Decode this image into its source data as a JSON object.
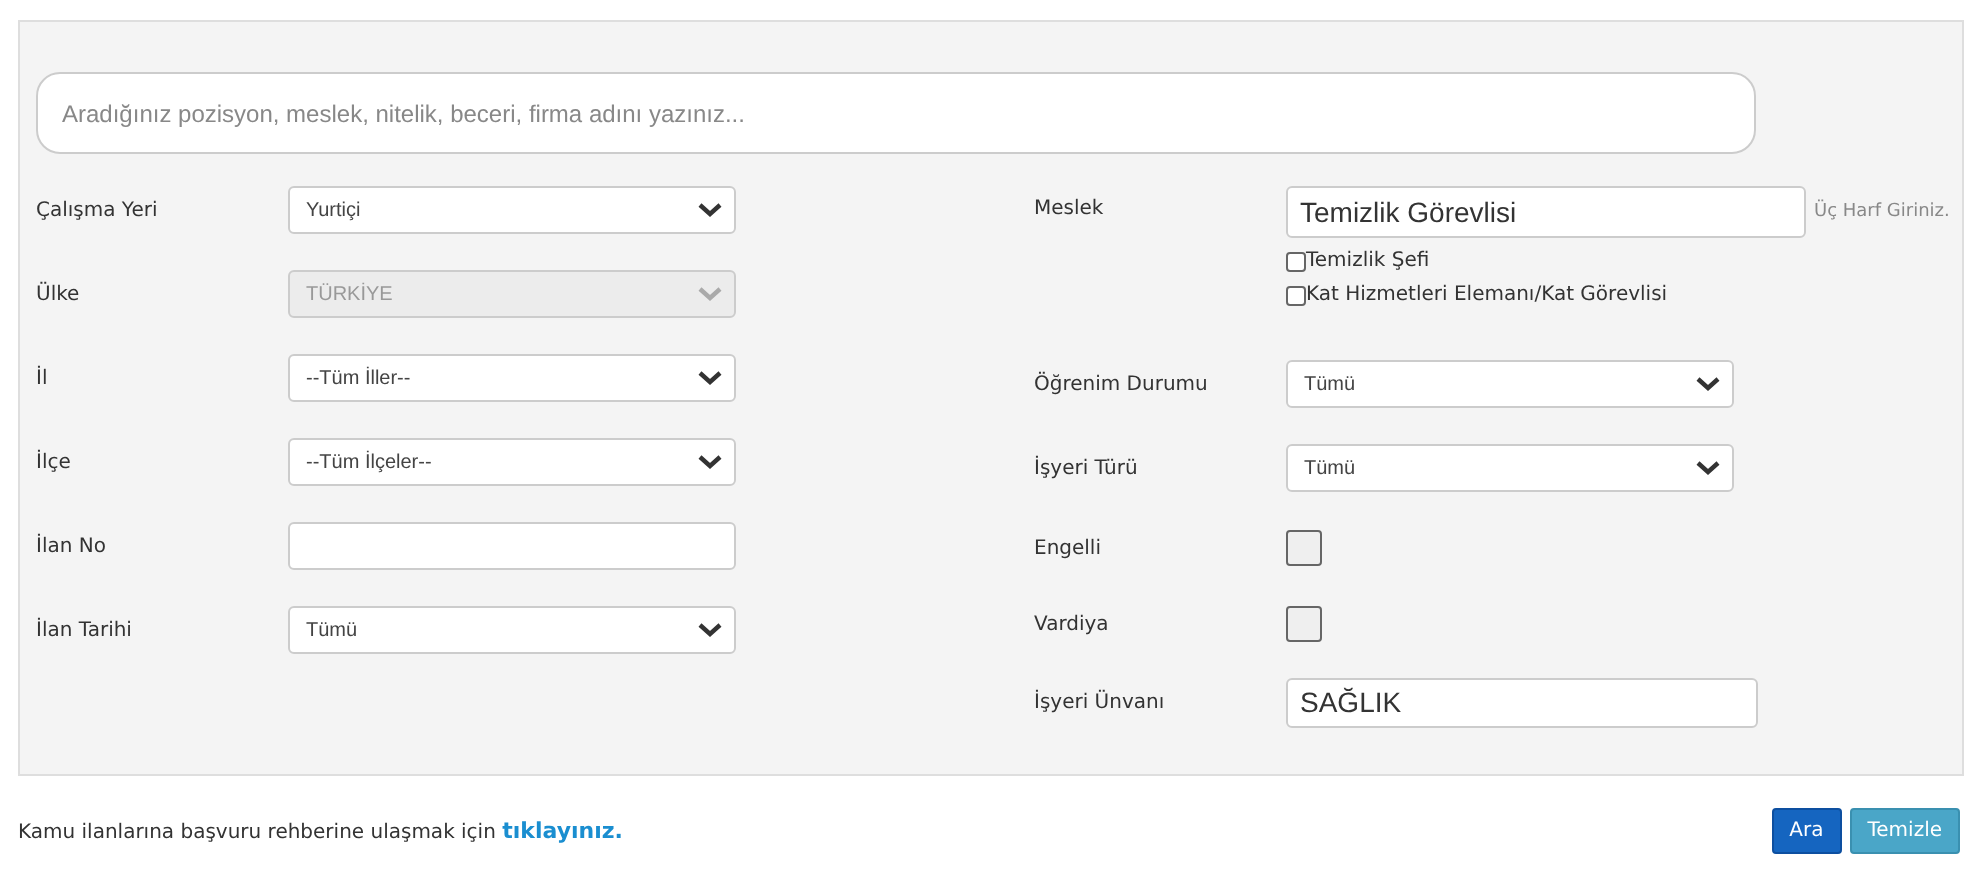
{
  "search": {
    "placeholder": "Aradığınız pozisyon, meslek, nitelik, beceri, firma adını yazınız..."
  },
  "left_fields": [
    {
      "kind": "select",
      "label": "Çalışma Yeri",
      "value": "Yurtiçi",
      "disabled": false
    },
    {
      "kind": "select",
      "label": "Ülke",
      "value": "TÜRKİYE",
      "disabled": true
    },
    {
      "kind": "select",
      "label": "İl",
      "value": "--Tüm İller--",
      "disabled": false
    },
    {
      "kind": "select",
      "label": "İlçe",
      "value": "--Tüm İlçeler--",
      "disabled": false
    },
    {
      "kind": "input",
      "label": "İlan No"
    },
    {
      "kind": "select",
      "label": "İlan Tarihi",
      "value": "Tümü",
      "disabled": false
    }
  ],
  "right_fields": [
    {
      "kind": "suggest",
      "label": "Meslek",
      "value": "Temizlik Görevlisi",
      "hint": "Üç Harf Giriniz.",
      "options": [
        {
          "label": "Temizlik Şefi",
          "checked": false
        },
        {
          "label": "Kat Hizmetleri Elemanı/Kat Görevlisi",
          "checked": false
        }
      ]
    },
    {
      "kind": "select",
      "label": "Öğrenim Durumu",
      "value": "Tümü",
      "disabled": false
    },
    {
      "kind": "select",
      "label": "İşyeri Türü",
      "value": "Tümü",
      "disabled": false
    },
    {
      "kind": "checkbox",
      "label": "Engelli",
      "checked": false
    },
    {
      "kind": "checkbox",
      "label": "Vardiya",
      "checked": false
    },
    {
      "kind": "input",
      "label": "İşyeri Ünvanı",
      "value": "SAĞLIK"
    }
  ],
  "footer": {
    "text": "Kamu ilanlarına başvuru rehberine ulaşmak için",
    "link": "tıklayınız."
  },
  "buttons": [
    {
      "label": "Ara",
      "kind": "primary"
    },
    {
      "label": "Temizle",
      "kind": "secondary"
    }
  ]
}
